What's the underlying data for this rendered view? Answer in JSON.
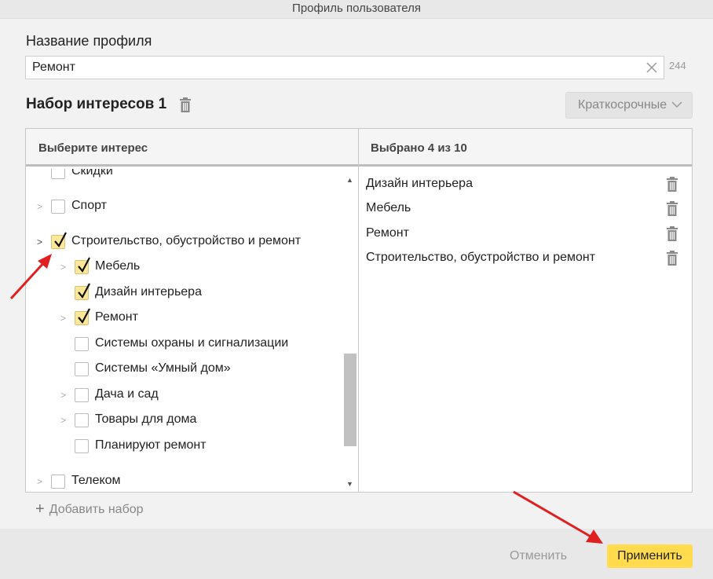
{
  "window": {
    "title": "Профиль пользователя"
  },
  "profile": {
    "name_label": "Название профиля",
    "name_value": "Ремонт",
    "char_counter": "244",
    "clear_icon": "close-icon"
  },
  "interest_set": {
    "title": "Набор интересов 1",
    "delete_icon": "trash-icon",
    "period_label": "Краткосрочные",
    "period_icon": "chevron-down-icon"
  },
  "panel": {
    "left_header": "Выберите интерес",
    "right_header": "Выбрано 4 из 10"
  },
  "tree_items": [
    {
      "label": "Скидки",
      "checked": false,
      "expandable": false,
      "level": 0
    },
    {
      "label": "Спорт",
      "checked": false,
      "expandable": true,
      "level": 0
    },
    {
      "label": "Строительство, обустройство и ремонт",
      "checked": true,
      "expandable": true,
      "level": 0
    },
    {
      "label": "Мебель",
      "checked": true,
      "expandable": true,
      "level": 1
    },
    {
      "label": "Дизайн интерьера",
      "checked": true,
      "expandable": false,
      "level": 1
    },
    {
      "label": "Ремонт",
      "checked": true,
      "expandable": true,
      "level": 1
    },
    {
      "label": "Системы охраны и сигнализации",
      "checked": false,
      "expandable": false,
      "level": 1
    },
    {
      "label": "Системы «Умный дом»",
      "checked": false,
      "expandable": false,
      "level": 1
    },
    {
      "label": "Дача и сад",
      "checked": false,
      "expandable": true,
      "level": 1
    },
    {
      "label": "Товары для дома",
      "checked": false,
      "expandable": true,
      "level": 1
    },
    {
      "label": "Планируют ремонт",
      "checked": false,
      "expandable": false,
      "level": 1
    },
    {
      "label": "Телеком",
      "checked": false,
      "expandable": true,
      "level": 0
    }
  ],
  "selected_items": [
    {
      "label": "Дизайн интерьера"
    },
    {
      "label": "Мебель"
    },
    {
      "label": "Ремонт"
    },
    {
      "label": "Строительство, обустройство и ремонт"
    }
  ],
  "add_set_label": "Добавить набор",
  "footer": {
    "cancel_label": "Отменить",
    "apply_label": "Применить"
  },
  "colors": {
    "accent_yellow": "#ffdb4d",
    "checkbox_checked": "#fde89a",
    "annotation_arrow": "#e02020"
  }
}
